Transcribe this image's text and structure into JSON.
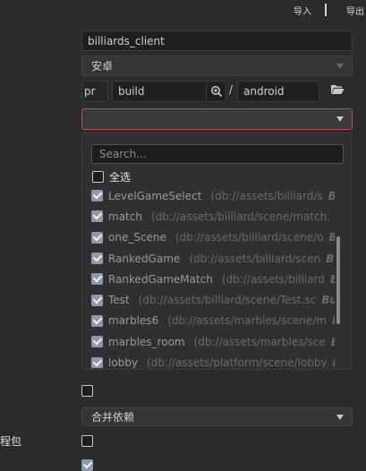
{
  "header": {
    "import_label": "导入",
    "export_label": "导出"
  },
  "fields": {
    "app_name": "billiards_client",
    "platform": "安卓",
    "path_prefix": "pr",
    "build_dir": "build",
    "slash": "/",
    "android_dir": "android",
    "merge_deps": "合并依赖",
    "row_label_left": "程包"
  },
  "popup": {
    "search_placeholder": "Search...",
    "select_all": "全选",
    "bundle_tag": "Bundle",
    "items": [
      {
        "name": "LevelGameSelect",
        "path": "(db://assets/billiard/s",
        "checked": true
      },
      {
        "name": "match",
        "path": "(db://assets/billiard/scene/match.",
        "checked": true
      },
      {
        "name": "one_Scene",
        "path": "(db://assets/billiard/scene/o",
        "checked": true
      },
      {
        "name": "RankedGame",
        "path": "(db://assets/billiard/scen",
        "checked": true
      },
      {
        "name": "RankedGameMatch",
        "path": "(db://assets/billiard",
        "checked": true
      },
      {
        "name": "Test",
        "path": "(db://assets/billiard/scene/Test.sc",
        "checked": true
      },
      {
        "name": "marbles6",
        "path": "(db://assets/marbles/scene/m",
        "checked": true
      },
      {
        "name": "marbles_room",
        "path": "(db://assets/marbles/sce",
        "checked": true
      },
      {
        "name": "lobby",
        "path": "(db://assets/platform/scene/lobby",
        "checked": true
      }
    ]
  },
  "colors": {
    "accent_border": "#c8494f",
    "checkbox_on": "#8f99ad"
  }
}
